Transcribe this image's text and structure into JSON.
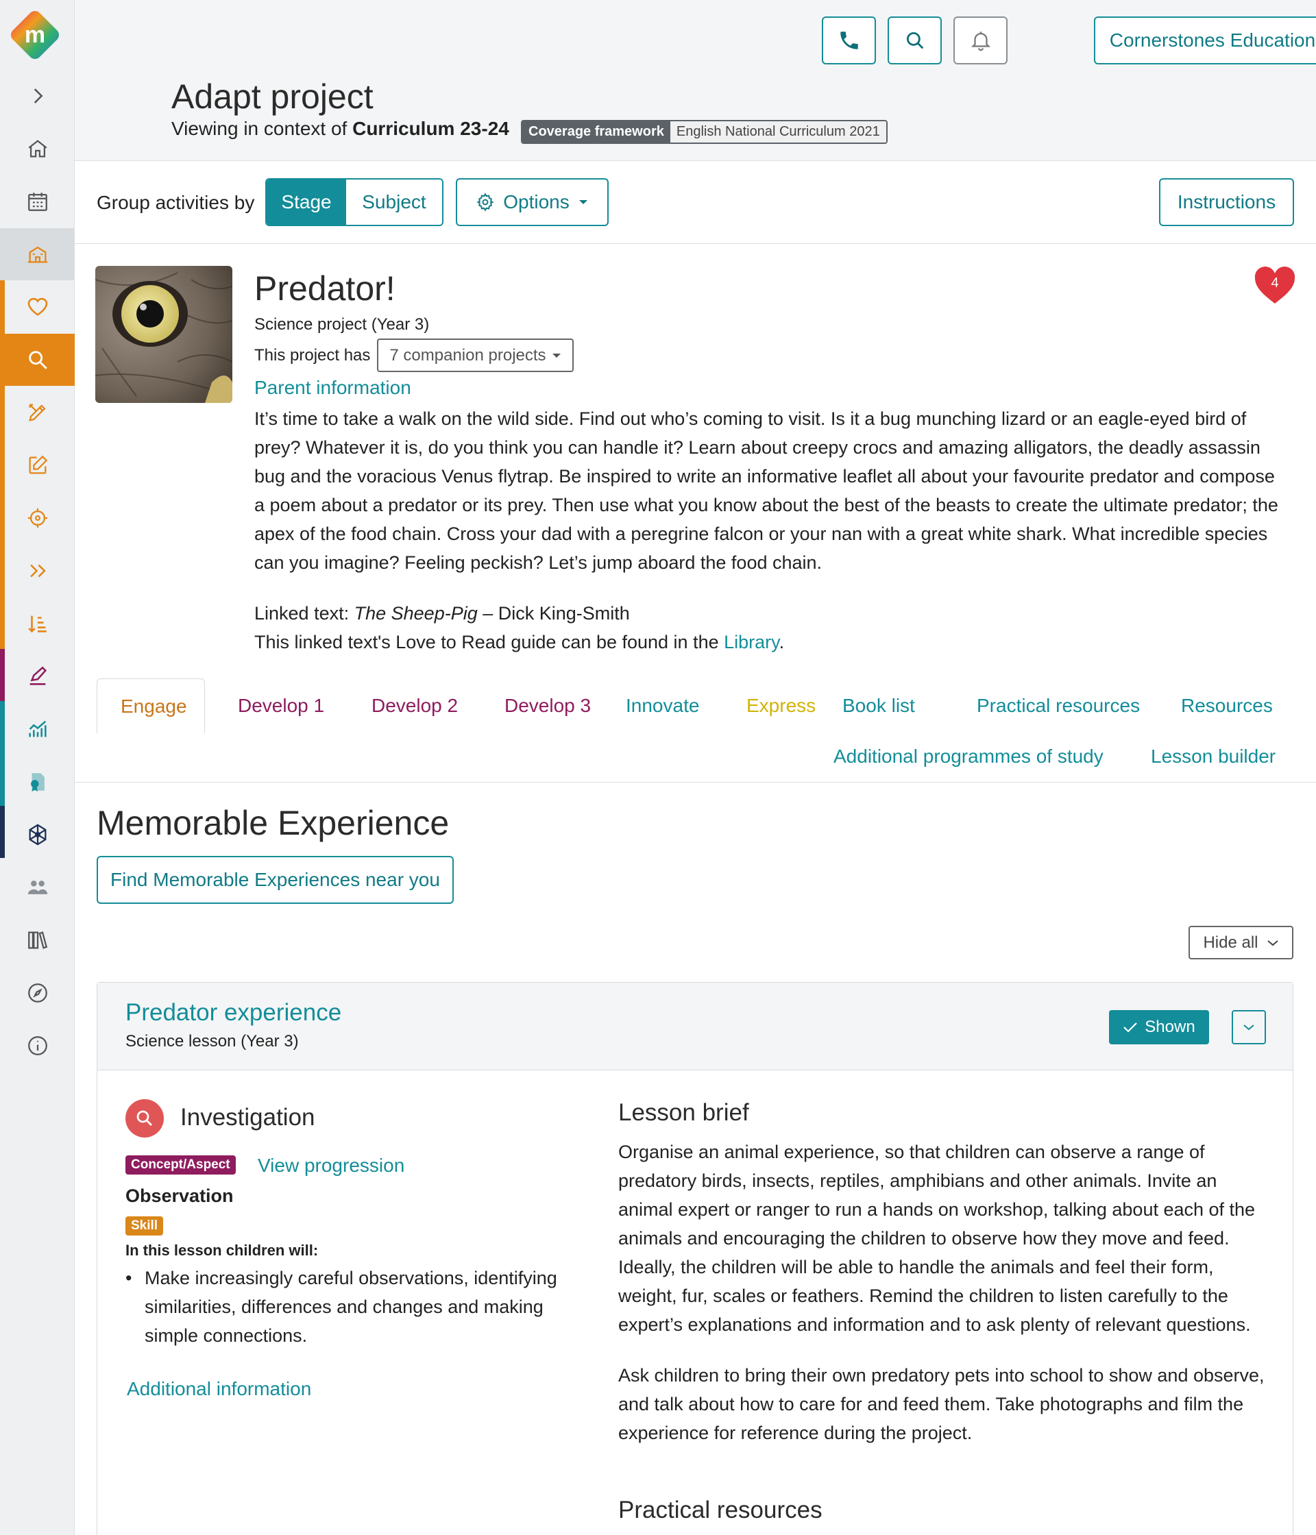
{
  "header": {
    "school_name": "Cornerstones Education",
    "page_title": "Adapt project",
    "context_prefix": "Viewing in context of",
    "context_name": "Curriculum 23-24",
    "coverage_key": "Coverage framework",
    "coverage_value": "English National Curriculum 2021"
  },
  "toolbar": {
    "group_label": "Group activities by",
    "stage_label": "Stage",
    "subject_label": "Subject",
    "options_label": "Options",
    "instructions_label": "Instructions"
  },
  "project": {
    "title": "Predator!",
    "subtitle": "Science project (Year 3)",
    "companion_prefix": "This project has",
    "companion_label": "7 companion projects",
    "parent_info": "Parent information",
    "favourites_count": "4",
    "blurb": "It’s time to take a walk on the wild side. Find out who’s coming to visit. Is it a bug munching lizard or an eagle-eyed bird of prey? Whatever it is, do you think you can handle it? Learn about creepy crocs and amazing alligators, the deadly assassin bug and the voracious Venus flytrap. Be inspired to write an informative leaflet all about your favourite predator and compose a poem about a predator or its prey. Then use what you know about the best of the beasts to create the ultimate predator; the apex of the food chain. Cross your dad with a peregrine falcon or your nan with a great white shark. What incredible species can you imagine? Feeling peckish? Let’s jump aboard the food chain.",
    "linked_prefix": "Linked text:",
    "linked_title": "The Sheep-Pig",
    "linked_author": " – Dick King-Smith",
    "guide_text": "This linked text's Love to Read guide can be found in the",
    "library_link": "Library",
    "guide_end": "."
  },
  "tabs": [
    {
      "label": "Engage",
      "color": "#c7761a"
    },
    {
      "label": "Develop 1",
      "color": "#8e1c5e"
    },
    {
      "label": "Develop 2",
      "color": "#8e1c5e"
    },
    {
      "label": "Develop 3",
      "color": "#8e1c5e"
    },
    {
      "label": "Innovate",
      "color": "#138d99"
    },
    {
      "label": "Express",
      "color": "#d2b306"
    },
    {
      "label": "Book list",
      "color": "#138d99"
    },
    {
      "label": "Practical resources",
      "color": "#138d99"
    },
    {
      "label": "Resources",
      "color": "#138d99"
    },
    {
      "label": "Additional programmes of study",
      "color": "#138d99"
    },
    {
      "label": "Lesson builder",
      "color": "#138d99"
    }
  ],
  "section": {
    "title": "Memorable Experience",
    "find_button": "Find Memorable Experiences near you",
    "hide_all": "Hide all"
  },
  "lesson": {
    "title": "Predator experience",
    "subtitle": "Science lesson (Year 3)",
    "shown_label": "Shown",
    "category": "Investigation",
    "concept_badge": "Concept/Aspect",
    "view_progression": "View progression",
    "concept_name": "Observation",
    "skill_badge": "Skill",
    "will_heading": "In this lesson children will:",
    "will_items": [
      "Make increasingly careful observations, identifying similarities, differences and changes and making simple connections."
    ],
    "additional_info": "Additional information",
    "brief_heading": "Lesson brief",
    "brief_p1": "Organise an animal experience, so that children can observe a range of predatory birds, insects, reptiles, amphibians and other animals. Invite an animal expert or ranger to run a hands on workshop, talking about each of the animals and encouraging the children to observe how they move and feed. Ideally, the children will be able to handle the animals and feel their form, weight, fur, scales or feathers. Remind the children to listen carefully to the expert’s explanations and information and to ask plenty of relevant questions.",
    "brief_p2": "Ask children to bring their own predatory pets into school to show and observe, and talk about how to care for and feed them. Take photographs and film the experience for reference during the project.",
    "practical_heading": "Practical resources"
  },
  "colors": {
    "teal": "#138d99",
    "orange": "#e38616",
    "magenta": "#8e1c5e",
    "skill": "#d9861a",
    "heart": "#e0343e"
  },
  "sidebar_icons": [
    "expand-icon",
    "home-icon",
    "calendar-icon",
    "school-icon",
    "heart-icon",
    "search-icon",
    "pencil-ruler-icon",
    "edit-icon",
    "target-icon",
    "chevrons-right-icon",
    "sort-icon",
    "write-icon",
    "chart-icon",
    "certificate-icon",
    "network-icon",
    "users-icon",
    "library-icon",
    "compass-icon",
    "info-icon"
  ]
}
